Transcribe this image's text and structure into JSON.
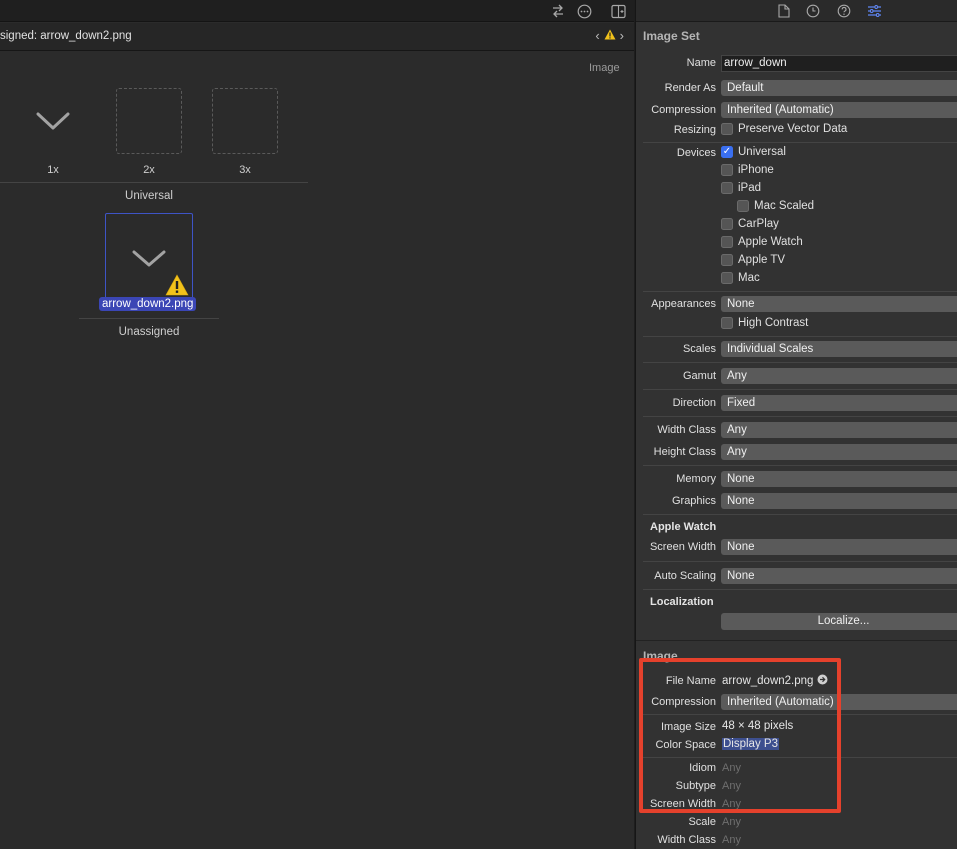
{
  "editor": {
    "jump_bar_title": "signed: arrow_down2.png",
    "section_label": "Image",
    "slots": [
      "1x",
      "2x",
      "3x"
    ],
    "group_universal": "Universal",
    "unassigned_filename": "arrow_down2.png",
    "group_unassigned": "Unassigned"
  },
  "inspector": {
    "image_set": {
      "title": "Image Set",
      "name_label": "Name",
      "name_value": "arrow_down",
      "render_as_label": "Render As",
      "render_as_value": "Default",
      "compression_label": "Compression",
      "compression_value": "Inherited (Automatic)",
      "resizing_label": "Resizing",
      "resizing_option": "Preserve Vector Data",
      "devices_label": "Devices",
      "devices": [
        {
          "label": "Universal",
          "checked": true
        },
        {
          "label": "iPhone",
          "checked": false
        },
        {
          "label": "iPad",
          "checked": false
        },
        {
          "label": "Mac Scaled",
          "checked": false
        },
        {
          "label": "CarPlay",
          "checked": false
        },
        {
          "label": "Apple Watch",
          "checked": false
        },
        {
          "label": "Apple TV",
          "checked": false
        },
        {
          "label": "Mac",
          "checked": false
        }
      ],
      "appearances_label": "Appearances",
      "appearances_value": "None",
      "high_contrast_label": "High Contrast",
      "scales_label": "Scales",
      "scales_value": "Individual Scales",
      "gamut_label": "Gamut",
      "gamut_value": "Any",
      "direction_label": "Direction",
      "direction_value": "Fixed",
      "width_class_label": "Width Class",
      "width_class_value": "Any",
      "height_class_label": "Height Class",
      "height_class_value": "Any",
      "memory_label": "Memory",
      "memory_value": "None",
      "graphics_label": "Graphics",
      "graphics_value": "None",
      "apple_watch_title": "Apple Watch",
      "screen_width_label": "Screen Width",
      "screen_width_value": "None",
      "auto_scaling_label": "Auto Scaling",
      "auto_scaling_value": "None",
      "localization_title": "Localization",
      "localize_button": "Localize..."
    },
    "image": {
      "title": "Image",
      "file_name_label": "File Name",
      "file_name_value": "arrow_down2.png",
      "compression_label": "Compression",
      "compression_value": "Inherited (Automatic)",
      "image_size_label": "Image Size",
      "image_size_value": "48 × 48 pixels",
      "color_space_label": "Color Space",
      "color_space_value": "Display P3",
      "idiom_label": "Idiom",
      "idiom_value": "Any",
      "subtype_label": "Subtype",
      "subtype_value": "Any",
      "screen_width_label": "Screen Width",
      "screen_width_value": "Any",
      "scale_label": "Scale",
      "scale_value": "Any",
      "width_class_label": "Width Class",
      "width_class_value": "Any"
    }
  },
  "colors": {
    "accent": "#3a6ff0",
    "selection": "#3b46b5",
    "highlight_box": "#e5412c",
    "warning": "#f2c21b"
  }
}
